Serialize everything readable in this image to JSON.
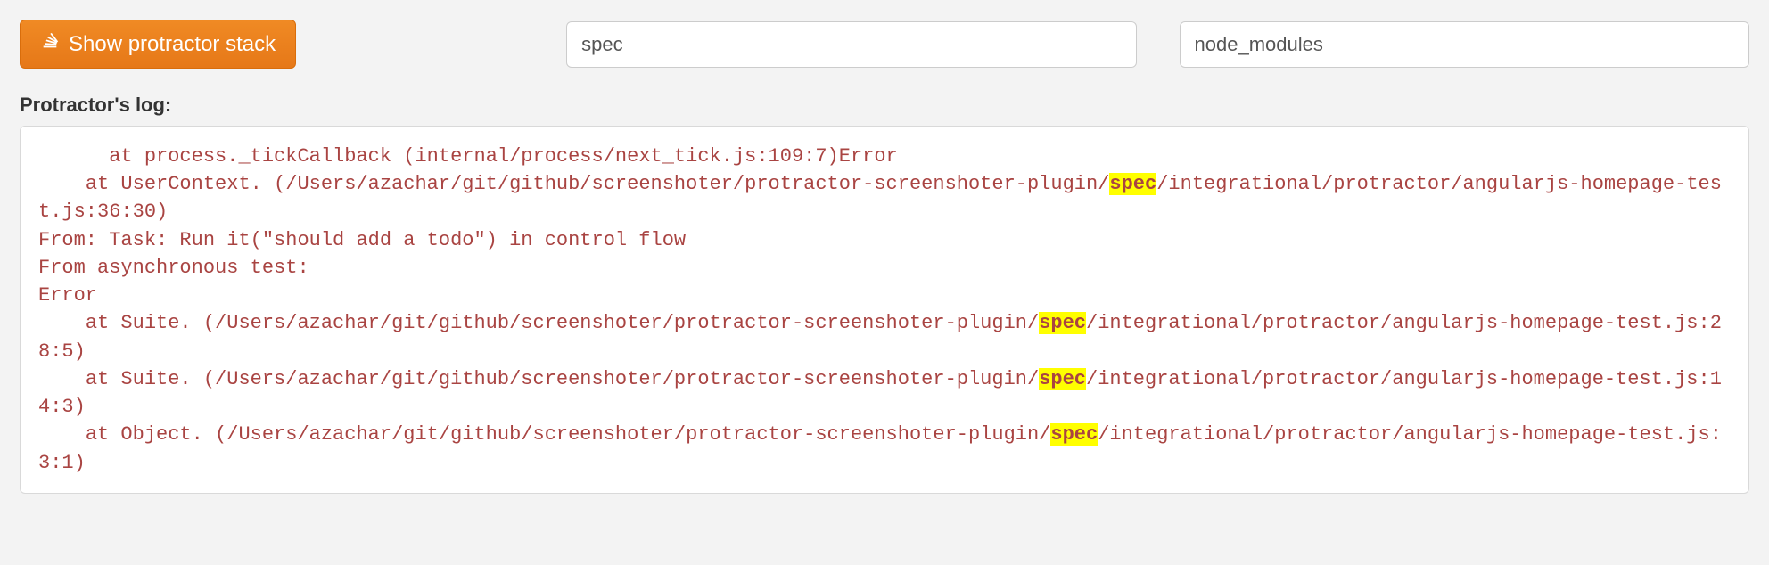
{
  "toolbar": {
    "stack_button_label": "Show protractor stack",
    "filter1_value": "spec",
    "filter2_value": "node_modules"
  },
  "log": {
    "label": "Protractor's log:",
    "highlight_term": "spec",
    "lines": [
      {
        "indent": 2,
        "segments": [
          {
            "t": "at process._tickCallback (internal/process/next_tick.js:109:7)Error"
          }
        ]
      },
      {
        "indent": 1,
        "segments": [
          {
            "t": "at UserContext. (/Users/azachar/git/github/screenshoter/protractor-screenshoter-plugin/"
          },
          {
            "t": "spec",
            "hl": true
          },
          {
            "t": "/integrational/protractor/angularjs-homepage-test.js:36:30)"
          }
        ]
      },
      {
        "indent": 0,
        "segments": [
          {
            "t": "From: Task: Run it(\"should add a todo\") in control flow"
          }
        ]
      },
      {
        "indent": 0,
        "segments": [
          {
            "t": "From asynchronous test:"
          }
        ]
      },
      {
        "indent": 0,
        "segments": [
          {
            "t": "Error"
          }
        ]
      },
      {
        "indent": 1,
        "segments": [
          {
            "t": "at Suite. (/Users/azachar/git/github/screenshoter/protractor-screenshoter-plugin/"
          },
          {
            "t": "spec",
            "hl": true
          },
          {
            "t": "/integrational/protractor/angularjs-homepage-test.js:28:5)"
          }
        ]
      },
      {
        "indent": 1,
        "segments": [
          {
            "t": "at Suite. (/Users/azachar/git/github/screenshoter/protractor-screenshoter-plugin/"
          },
          {
            "t": "spec",
            "hl": true
          },
          {
            "t": "/integrational/protractor/angularjs-homepage-test.js:14:3)"
          }
        ]
      },
      {
        "indent": 1,
        "segments": [
          {
            "t": "at Object. (/Users/azachar/git/github/screenshoter/protractor-screenshoter-plugin/"
          },
          {
            "t": "spec",
            "hl": true
          },
          {
            "t": "/integrational/protractor/angularjs-homepage-test.js:3:1)"
          }
        ]
      }
    ]
  }
}
